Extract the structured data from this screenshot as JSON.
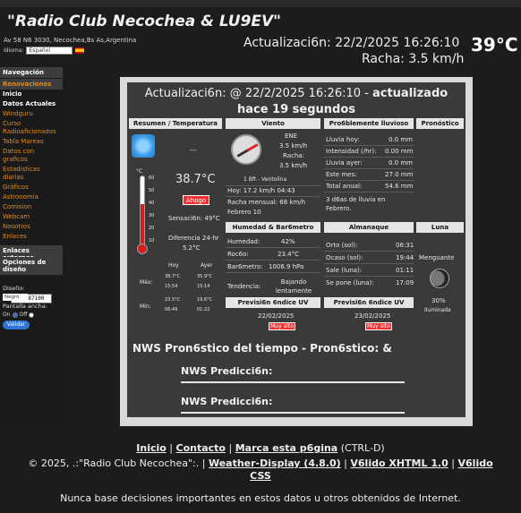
{
  "header": {
    "title": "\"Radio Club Necochea & LU9EV\"",
    "address": "Av 58 N6 3030, Necochea,Bs As,Argentina",
    "language_label": "Idioma:",
    "language_value": "Español",
    "update": "Actualizaci6n:  22/2/2025  16:26:10",
    "temp": "39°C",
    "gust": "Racha: 3.5 km/h"
  },
  "sidebar": {
    "nav_title": "Navegación",
    "renov": "Renovaciones",
    "items": [
      "Inicio",
      "Datos Actuales",
      "Windguru",
      "Curso Radioaficionados",
      "Tabla Mareas",
      "Datos con graficos",
      "Estadísticas diarias",
      "Gráficos",
      "Astronomía",
      "Comision",
      "Webcam",
      "Nosotros",
      "Enlaces"
    ],
    "links_title": "Enlaces externos",
    "counter": "02187100",
    "design_title": "Opciones de diseño",
    "design_label": "Diseño:",
    "design_value": "Negro",
    "wide_label": "Pantalla ancha:",
    "on_label": "On",
    "off_label": "Off",
    "validate": "Validar"
  },
  "main": {
    "banner_a": "Actualizaci6n: @ 22/2/2025 16:26:10 -",
    "banner_b": "actualizado hace 19 segundos",
    "headers": {
      "summary": "Resumen / Temperatura",
      "wind": "Viento",
      "rain": "Pro6blemente lluvioso",
      "forecast": "Pronóstico"
    },
    "summary": {
      "dashes": "---",
      "temp": "38.7°C",
      "trend": "Ahogo",
      "feels": "Sensaci6n: 49°C",
      "diff_label": "Diferencia 24-hr",
      "diff_value": "5.2°C",
      "today": "Hoy",
      "yesterday": "Ayer",
      "max_label": "Máx:",
      "min_label": "Mín:",
      "max_today": "38.7°C",
      "max_today_time": "15:54",
      "max_yday": "35.9°C",
      "max_yday_time": "15:14",
      "min_today": "23.5°C",
      "min_today_time": "06:49",
      "min_yday": "19.6°C",
      "min_yday_time": "01:22",
      "thermo_ticks": [
        "°C",
        "60",
        "50",
        "40",
        "30",
        "20",
        "10"
      ]
    },
    "wind": {
      "dir": "ENE",
      "speed": "3.5 km/h",
      "gust_label": "Racha:",
      "gust": "3.5 km/h",
      "bft": "1 Bft - Ventolina",
      "max_today": "Hoy: 17.2 km/h 04:43",
      "monthly": "Racha mensual: 68 km/h",
      "monthly_date": "Febrero 10"
    },
    "rain": {
      "rows": [
        {
          "label": "Lluvia hoy:",
          "value": "0.0 mm"
        },
        {
          "label": "Intensidad (/hr):",
          "value": "0.00 mm"
        },
        {
          "label": "Lluvia ayer:",
          "value": "0.0 mm"
        },
        {
          "label": "Este mes:",
          "value": "27.0 mm"
        },
        {
          "label": "Total anual:",
          "value": "54.6 mm"
        }
      ],
      "note": "3 d6as de lluvia en Febrero."
    },
    "humidity": {
      "header": "Humedad & Bar6metro",
      "hum_label": "Humedad:",
      "hum": "42%",
      "dew_label": "Roc6o:",
      "dew": "23.4°C",
      "baro_label": "Bar6metro:",
      "baro": "1006.9 hPa",
      "trend_label": "Tendencia:",
      "trend": "Bajando lentamente"
    },
    "almanac": {
      "header": "Almanaque",
      "rows": [
        {
          "label": "Orto (sol):",
          "value": "06:31"
        },
        {
          "label": "Ocaso (sol):",
          "value": "19:44"
        },
        {
          "label": "Sale (luna):",
          "value": "01:11"
        },
        {
          "label": "Se pone (luna):",
          "value": "17:09"
        }
      ]
    },
    "moon": {
      "header": "Luna",
      "phase": "Menguante",
      "illum_pct": "30%",
      "illum_label": "Iluminada"
    },
    "uv1": {
      "header": "Previsi6n 6ndice UV",
      "date": "22/02/2025",
      "value": "Muy alto"
    },
    "uv2": {
      "header": "Previsi6n 6ndice UV",
      "date": "23/02/2025",
      "value": "Muy alto"
    },
    "nws_title": "NWS Pron6stico del tiempo  - Pron6stico:  &",
    "nws_pred1": "NWS Predicci6n:",
    "nws_pred2": "NWS Predicci6n:"
  },
  "footer": {
    "home": "Inicio",
    "contact": "Contacto",
    "bookmark": "Marca esta p6gina",
    "bookmark_keys": " (CTRL-D)",
    "copy_a": "© 2025, .:\"Radio Club Necochea\":. |",
    "wd": "Weather-Display (4.8.0)",
    "xhtml": "V6lido XHTML 1.0",
    "css_a": "V6lido",
    "css_b": "CSS",
    "disclaimer": "Nunca base decisiones importantes en estos datos u otros obtenidos de Internet."
  },
  "colors": {
    "accent_orange": "#e08a1e",
    "alert_red": "#f03030",
    "button_blue": "#2d74d6"
  }
}
